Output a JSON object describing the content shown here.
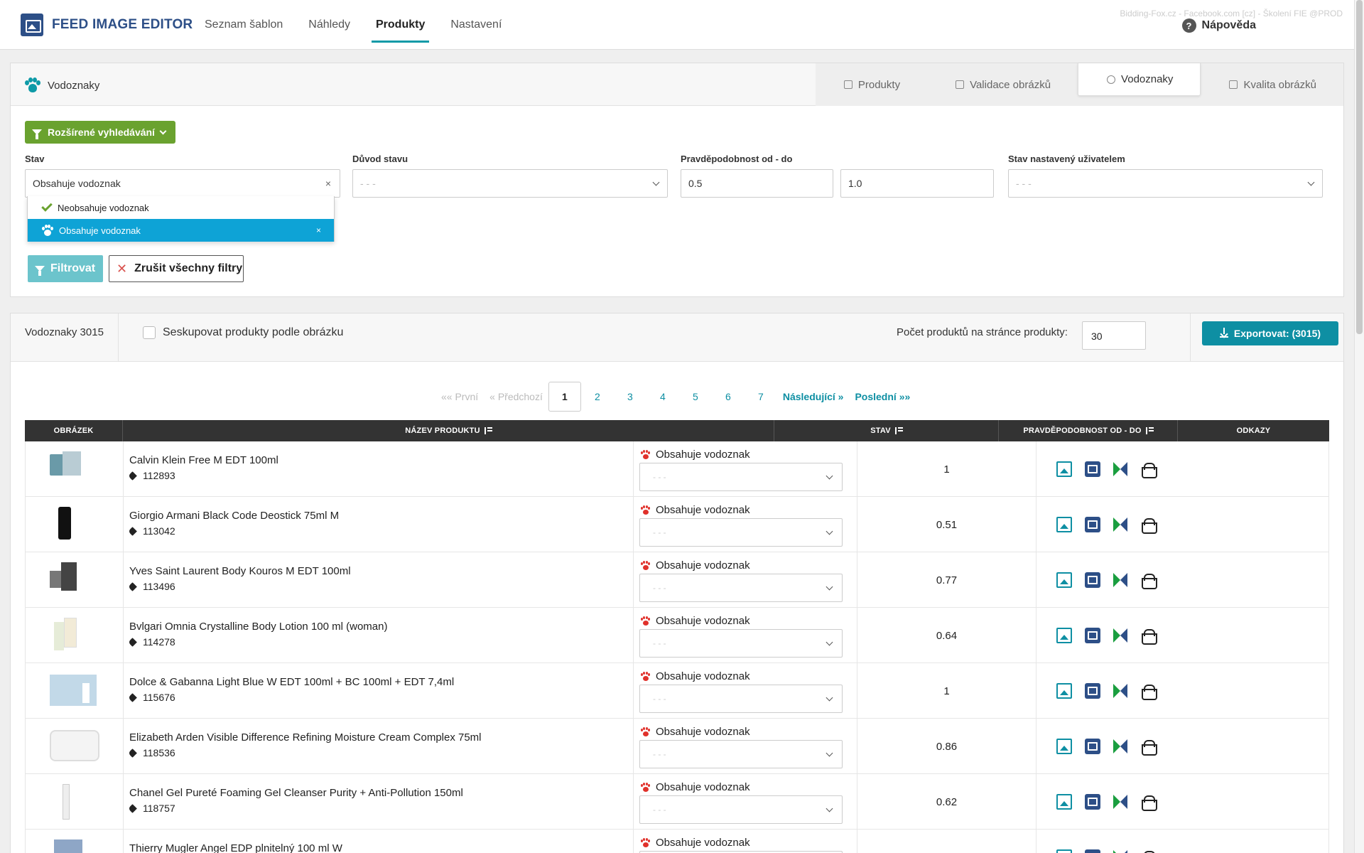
{
  "app": {
    "title": "FEED IMAGE EDITOR",
    "env": "Bidding-Fox.cz - Facebook.com [cz] - Školení FIE @PROD",
    "help": "Nápověda"
  },
  "nav": [
    "Seznam šablon",
    "Náhledy",
    "Produkty",
    "Nastavení"
  ],
  "nav_active": "Produkty",
  "panel": {
    "title": "Vodoznaky",
    "tabs": [
      "Produkty",
      "Validace obrázků",
      "Vodoznaky",
      "Kvalita obrázků"
    ],
    "tab_active": "Vodoznaky"
  },
  "filters": {
    "advanced_label": "Rozšírené vyhledávání",
    "state_label": "Stav",
    "state_value": "Obsahuje vodoznak",
    "reason_label": "Důvod stavu",
    "reason_placeholder": "- - -",
    "prob_label": "Pravděpodobnost od - do",
    "prob_from": "0.5",
    "prob_to": "1.0",
    "user_state_label": "Stav nastavený uživatelem",
    "user_state_placeholder": "- - -",
    "options": [
      "Neobsahuje vodoznak",
      "Obsahuje vodoznak"
    ],
    "filter_button": "Filtrovat",
    "clear_button": "Zrušit všechny filtry"
  },
  "results": {
    "count_label": "Vodoznaky 3015",
    "group_label": "Seskupovat produkty podle obrázku",
    "per_page_label": "Počet produktů na stránce produkty:",
    "per_page_value": "30",
    "export_label": "Exportovat: (3015)"
  },
  "pager": {
    "first": "«« První",
    "prev": "« Předchozí",
    "pages": [
      "1",
      "2",
      "3",
      "4",
      "5",
      "6",
      "7"
    ],
    "current": "1",
    "next": "Následující »",
    "last": "Poslední »»"
  },
  "table": {
    "headers": [
      "OBRÁZEK",
      "NÁZEV PRODUKTU",
      "STAV",
      "PRAVDĚPODOBNOST OD - DO",
      "ODKAZY"
    ],
    "select_placeholder": "- - -",
    "rows": [
      {
        "name": "Calvin Klein Free M EDT 100ml",
        "id": "112893",
        "state": "Obsahuje vodoznak",
        "prob": "1"
      },
      {
        "name": "Giorgio Armani Black Code Deostick 75ml M",
        "id": "113042",
        "state": "Obsahuje vodoznak",
        "prob": "0.51"
      },
      {
        "name": "Yves Saint Laurent Body Kouros M EDT 100ml",
        "id": "113496",
        "state": "Obsahuje vodoznak",
        "prob": "0.77"
      },
      {
        "name": "Bvlgari Omnia Crystalline Body Lotion 100 ml (woman)",
        "id": "114278",
        "state": "Obsahuje vodoznak",
        "prob": "0.64"
      },
      {
        "name": "Dolce & Gabanna Light Blue W EDT 100ml + BC 100ml + EDT 7,4ml",
        "id": "115676",
        "state": "Obsahuje vodoznak",
        "prob": "1"
      },
      {
        "name": "Elizabeth Arden Visible Difference Refining Moisture Cream Complex 75ml",
        "id": "118536",
        "state": "Obsahuje vodoznak",
        "prob": "0.86"
      },
      {
        "name": "Chanel Gel Pureté Foaming Gel Cleanser Purity + Anti-Pollution 150ml",
        "id": "118757",
        "state": "Obsahuje vodoznak",
        "prob": "0.62"
      },
      {
        "name": "Thierry Mugler Angel EDP plnitelný 100 ml W",
        "id": "",
        "state": "Obsahuje vodoznak",
        "prob": ""
      }
    ]
  },
  "colors": {
    "accent": "#0e9aa7",
    "brand": "#2d4f87",
    "green": "#6aa22f",
    "selected": "#0ea3d6",
    "paw_red": "#e0312b"
  }
}
